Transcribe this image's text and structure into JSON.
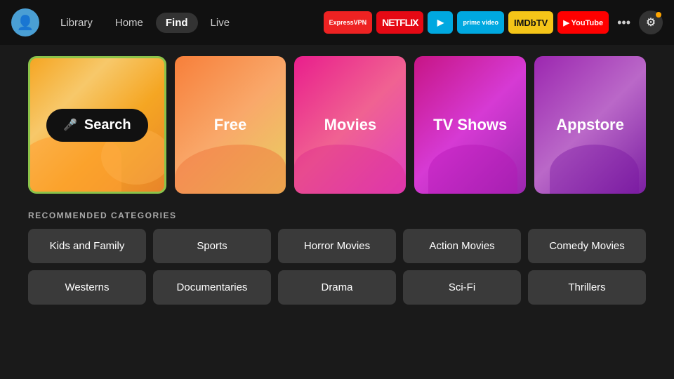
{
  "nav": {
    "avatar_icon": "👤",
    "links": [
      {
        "label": "Library",
        "active": false
      },
      {
        "label": "Home",
        "active": false
      },
      {
        "label": "Find",
        "active": true
      },
      {
        "label": "Live",
        "active": false
      }
    ],
    "apps": [
      {
        "label": "ExpressVPN",
        "class": "icon-expressvpn"
      },
      {
        "label": "NETFLIX",
        "class": "icon-netflix"
      },
      {
        "label": "▶",
        "class": "icon-freevee"
      },
      {
        "label": "prime video",
        "class": "icon-prime"
      },
      {
        "label": "IMDbTV",
        "class": "icon-imdb"
      },
      {
        "label": "▶ YouTube",
        "class": "icon-youtube"
      }
    ],
    "more_label": "•••",
    "settings_icon": "⚙"
  },
  "tiles": [
    {
      "id": "search",
      "label": "Search",
      "type": "search"
    },
    {
      "id": "free",
      "label": "Free",
      "type": "free"
    },
    {
      "id": "movies",
      "label": "Movies",
      "type": "movies"
    },
    {
      "id": "tvshows",
      "label": "TV Shows",
      "type": "tvshows"
    },
    {
      "id": "appstore",
      "label": "Appstore",
      "type": "appstore"
    }
  ],
  "recommended": {
    "title": "RECOMMENDED CATEGORIES",
    "rows": [
      [
        "Kids and Family",
        "Sports",
        "Horror Movies",
        "Action Movies",
        "Comedy Movies"
      ],
      [
        "Westerns",
        "Documentaries",
        "Drama",
        "Sci-Fi",
        "Thrillers"
      ]
    ]
  }
}
